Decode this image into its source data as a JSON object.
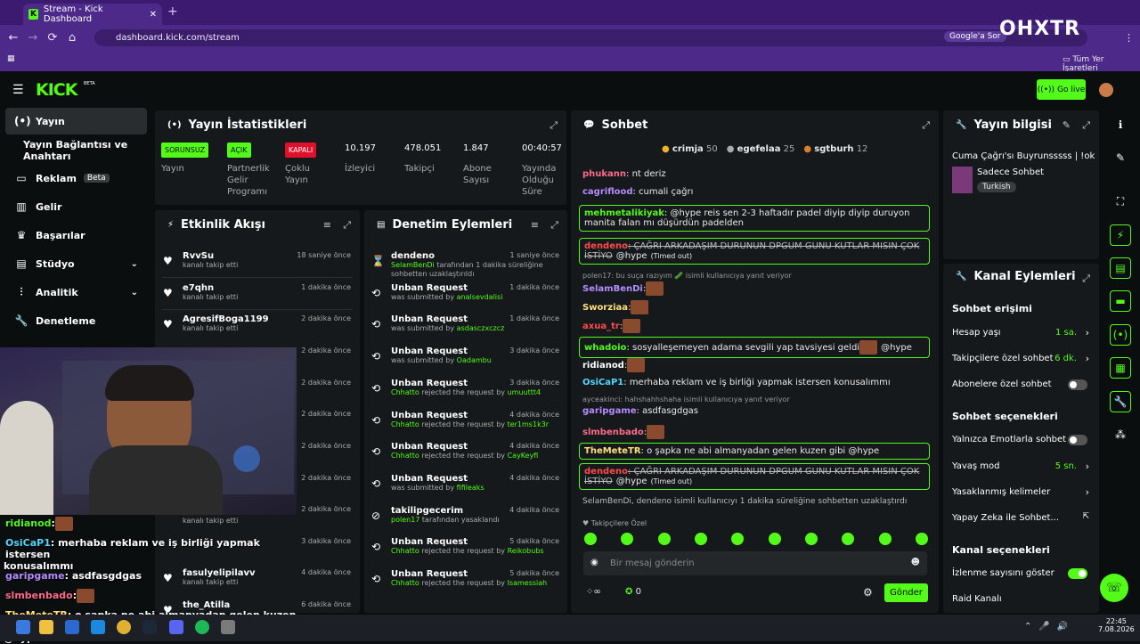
{
  "browser": {
    "tab_title": "Stream - Kick Dashboard",
    "url": "dashboard.kick.com/stream",
    "search_engine": "Google'a Sor",
    "bookmarks_label": "Tüm Yer İşaretleri",
    "watermark": "OHXTR"
  },
  "header": {
    "logo": "KICK",
    "beta": "BETA",
    "go_live": "Go live"
  },
  "sidebar": {
    "items": [
      {
        "label": "Yayın",
        "icon": "stream-icon"
      },
      {
        "label": "Yayın Bağlantısı ve Anahtarı"
      },
      {
        "label": "Reklam",
        "badge": "Beta",
        "icon": "ad-icon"
      },
      {
        "label": "Gelir",
        "icon": "revenue-icon"
      },
      {
        "label": "Başarılar",
        "icon": "trophy-icon"
      },
      {
        "label": "Stüdyo",
        "icon": "studio-icon"
      },
      {
        "label": "Analitik",
        "icon": "analytics-icon"
      },
      {
        "label": "Denetleme",
        "icon": "moderation-icon"
      }
    ]
  },
  "stats": {
    "title": "Yayın İstatistikleri",
    "items": [
      {
        "tag": "SORUNSUZ",
        "label": "Yayın",
        "tag_color": "#53fc18"
      },
      {
        "tag": "AÇIK",
        "label": "Partnerlik Gelir Programı",
        "tag_color": "#53fc18"
      },
      {
        "tag": "KAPALI",
        "label": "Çoklu Yayın",
        "tag_color": "#e0102a"
      },
      {
        "value": "10.197",
        "label": "İzleyici"
      },
      {
        "value": "478.051",
        "label": "Takipçi"
      },
      {
        "value": "1.847",
        "label": "Abone Sayısı"
      },
      {
        "value": "00:40:57",
        "label": "Yayında Olduğu Süre"
      }
    ]
  },
  "activity": {
    "title": "Etkinlik Akışı",
    "rows": [
      {
        "name": "RvvSu",
        "sub": "kanalı takip etti",
        "time": "18 saniye önce"
      },
      {
        "name": "e7qhn",
        "sub": "kanalı takip etti",
        "time": "1 dakika önce"
      },
      {
        "name": "AgresifBoga1199",
        "sub": "kanalı takip etti",
        "time": "2 dakika önce"
      },
      {
        "time": "2 dakika önce"
      },
      {
        "time": "2 dakika önce"
      },
      {
        "time": "2 dakika önce"
      },
      {
        "time": "2 dakika önce"
      },
      {
        "time": "2 dakika önce"
      },
      {
        "time": "2 dakika önce"
      },
      {
        "sub": "kanalı takip etti",
        "time": ""
      },
      {
        "time": "3 dakika önce"
      },
      {
        "name": "fasulyelipilavv",
        "sub": "kanalı takip etti",
        "time": "4 dakika önce"
      },
      {
        "name": "the_Atilla",
        "time": "6 dakika önce"
      }
    ]
  },
  "moderation": {
    "title": "Denetim Eylemleri",
    "rows": [
      {
        "name": "dendeno",
        "time": "1 saniye önce",
        "actor": "SelamBenDi",
        "sub": " tarafından 1 dakika süreliğine sohbetten uzaklaştırıldı"
      },
      {
        "name": "Unban Request",
        "time": "1 dakika önce",
        "sub": "was submitted by ",
        "actor": "analsevdalisi"
      },
      {
        "name": "Unban Request",
        "time": "1 dakika önce",
        "sub": "was submitted by ",
        "actor": "asdasczxczcz"
      },
      {
        "name": "Unban Request",
        "time": "3 dakika önce",
        "sub": "was submitted by ",
        "actor": "Oadambu"
      },
      {
        "name": "Unban Request",
        "time": "3 dakika önce",
        "actor": "Chhatto",
        "sub": " rejected the request by ",
        "target": "umuuttt4"
      },
      {
        "name": "Unban Request",
        "time": "4 dakika önce",
        "actor": "Chhatto",
        "sub": " rejected the request by ",
        "target": "ter1ms1k3r"
      },
      {
        "name": "Unban Request",
        "time": "4 dakika önce",
        "actor": "Chhatto",
        "sub": " rejected the request by ",
        "target": "CayKeyfi"
      },
      {
        "name": "Unban Request",
        "time": "4 dakika önce",
        "sub": "was submitted by ",
        "actor": "fifileaks"
      },
      {
        "name": "takilipgecerim",
        "time": "4 dakika önce",
        "actor": "polen17",
        "sub": " tarafından yasaklandı"
      },
      {
        "name": "Unban Request",
        "time": "5 dakika önce",
        "actor": "Chhatto",
        "sub": " rejected the request by ",
        "target": "Reikobubs"
      },
      {
        "name": "Unban Request",
        "time": "5 dakika önce",
        "actor": "Chhatto",
        "sub": " rejected the request by ",
        "target": "Isamessiah"
      }
    ]
  },
  "chat": {
    "title": "Sohbet",
    "top": [
      {
        "name": "crimja",
        "n": "50"
      },
      {
        "name": "egefelaa",
        "n": "25"
      },
      {
        "name": "sgtburh",
        "n": "12"
      }
    ],
    "lines": [
      {
        "user": "phukann",
        "color": "#ff6b8a",
        "text": ": nt deriz"
      },
      {
        "user": "cagriflood",
        "color": "#b48cff",
        "text": ": cumali çağrı"
      },
      {
        "user": "mehmetalikiyak",
        "color": "#53fc18",
        "text": ": @hype reis sen 2-3 haftadır padel diyip diyip duruyon manita falan mı düşürdün padelden"
      },
      {
        "user": "dendeno",
        "color": "#ff4b4b",
        "text": ": ÇAĞRI ARKADAŞIM DURUNUN DPGUM GUNU KUTLAR MISIN ÇOK İSTİYO",
        "extra": "@hype",
        "timed": "(Timed out)"
      },
      {
        "reply": "polen17: bu suça razıyım 🥒 isimli kullanıcıya yanıt veriyor"
      },
      {
        "user": "SelamBenDi",
        "color": "#b48cff",
        "text": ":"
      },
      {
        "user": "Sworziaa",
        "color": "#ffe07a",
        "text": ":"
      },
      {
        "user": "axua_tr",
        "color": "#ff4b4b",
        "text": ":"
      },
      {
        "user": "whadoio",
        "color": "#53fc18",
        "text": ": sosyalleşemeyen adama sevgili yap tavsiyesi geldi",
        "extra": "@hype"
      },
      {
        "user": "ridianod",
        "color": "#ffffff",
        "text": ":"
      },
      {
        "user": "OsiCaP1",
        "color": "#53d7fc",
        "text": ": merhaba reklam ve iş birliği yapmak istersen konusalımmı"
      },
      {
        "reply": "ayceakinci: hahshahhshaha isimli kullanıcıya yanıt veriyor"
      },
      {
        "user": "garipgame",
        "color": "#b48cff",
        "text": ": asdfasgdgas"
      },
      {
        "user": "slmbenbado",
        "color": "#ff6b8a",
        "text": ":"
      },
      {
        "user": "TheMeteTR",
        "color": "#ffe07a",
        "text": ": o şapka ne abi almanyadan gelen kuzen gibi @hype"
      },
      {
        "user": "dendeno",
        "color": "#ff4b4b",
        "text": ": ÇAĞRI ARKADAŞIM DURUNUN DPGUM GUNU KUTLAR MISIN ÇOK İSTİYO",
        "extra": "@hype",
        "timed": "(Timed out)"
      },
      {
        "system": "SelamBenDi, dendeno isimli kullanıcıyı 1 dakika süreliğine sohbetten uzaklaştırdı"
      }
    ],
    "followers_only": "Takipçilere Özel",
    "placeholder": "Bir mesaj gönderin",
    "send": "Gönder",
    "count": "0"
  },
  "info": {
    "title": "Yayın bilgisi",
    "stream_title": "Cuma Çağrı'sı Buyrunsssss | !okxtr",
    "category": "Sadece Sohbet",
    "language": "Turkish"
  },
  "channel": {
    "title": "Kanal Eylemleri",
    "chat_access": "Sohbet erişimi",
    "account_age": "Hesap yaşı",
    "account_age_val": "1 sa.",
    "followers_chat": "Takipçilere özel sohbet",
    "followers_chat_val": "6 dk.",
    "subs_chat": "Abonelere özel sohbet",
    "chat_options": "Sohbet seçenekleri",
    "emotes_only": "Yalnızca Emotlarla sohbet",
    "slow": "Yavaş mod",
    "slow_val": "5 sn.",
    "banned_words": "Yasaklanmış kelimeler",
    "ai": "Yapay Zeka ile Sohbet...",
    "channel_options": "Kanal seçenekleri",
    "viewer_count": "İzlenme sayısını göster",
    "raid": "Raid Kanalı"
  },
  "overlay": [
    {
      "user": "ridianod",
      "text": ":",
      "color": "#53fc18"
    },
    {
      "user": "OsiCaP1",
      "text": ": merhaba reklam ve iş birliği yapmak istersen",
      "color": "#53d7fc",
      "cont": "konusalımmı"
    },
    {
      "user": "garipgame",
      "text": ": asdfasgdgas",
      "color": "#b48cff"
    },
    {
      "user": "slmbenbado",
      "text": ":",
      "color": "#ff6b8a"
    },
    {
      "user": "TheMeteTR",
      "text": ": o şapka ne abi almanyadan gelen kuzen gibi",
      "color": "#ffe07a",
      "cont": "@hype"
    }
  ],
  "taskbar": {
    "time": "22:45",
    "date": "7.08.2026"
  }
}
